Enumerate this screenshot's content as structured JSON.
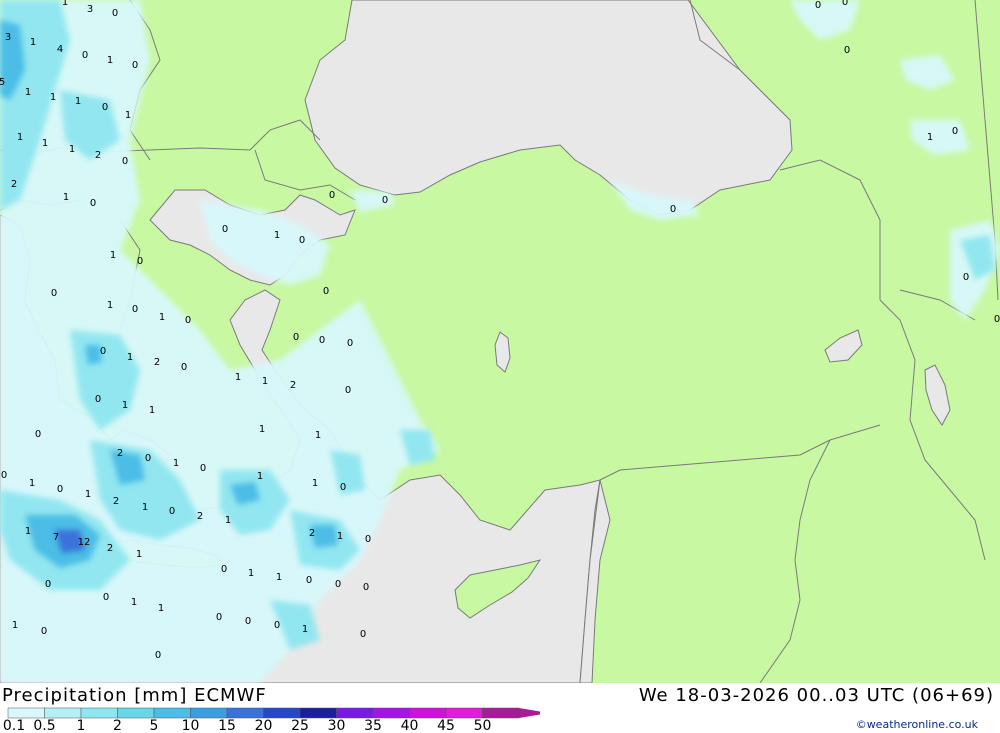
{
  "title": {
    "left": "Precipitation [mm] ECMWF",
    "right": "We 18-03-2026 00..03 UTC (06+69)"
  },
  "credit": "©weatheronline.co.uk",
  "legend": {
    "labels": [
      "0.1",
      "0.5",
      "1",
      "2",
      "5",
      "10",
      "15",
      "20",
      "25",
      "30",
      "35",
      "40",
      "45",
      "50"
    ],
    "colors": [
      "#d8f8fb",
      "#b4f0f6",
      "#8ee6f0",
      "#6ad6ea",
      "#4cbde6",
      "#3c9ee0",
      "#3a72da",
      "#2648c8",
      "#1a1f9e",
      "#7a18e6",
      "#a414e6",
      "#d010dc",
      "#e41adc",
      "#a81a9a"
    ]
  },
  "map": {
    "colors": {
      "land": "#c8f8a2",
      "sea": "#e8e8e8",
      "border": "#7a7a7a",
      "precip_light": "#d8f8fb",
      "precip_mid": "#8ee6f0",
      "precip_heavy": "#4cbde6",
      "precip_max": "#3a72da"
    },
    "point_values": [
      "1",
      "3",
      "0",
      "3",
      "1",
      "4",
      "5",
      "0",
      "1",
      "1",
      "0",
      "1",
      "1",
      "1",
      "0",
      "1",
      "1",
      "1",
      "2",
      "0",
      "2",
      "1",
      "0",
      "0",
      "0",
      "0",
      "1",
      "1",
      "0",
      "0",
      "0",
      "0",
      "1",
      "0",
      "1",
      "0",
      "0",
      "1",
      "2",
      "0",
      "0",
      "1",
      "2",
      "0",
      "1",
      "1",
      "0",
      "1",
      "0",
      "2",
      "0",
      "1",
      "1",
      "0",
      "1",
      "0",
      "2",
      "1",
      "0",
      "2",
      "1",
      "7",
      "12",
      "2",
      "1",
      "0",
      "0",
      "1",
      "1",
      "1",
      "0",
      "0",
      "0",
      "1",
      "0",
      "0",
      "0",
      "1",
      "0",
      "0",
      "0",
      "0",
      "1",
      "0",
      "0",
      "1",
      "1",
      "0",
      "2",
      "0",
      "0"
    ]
  }
}
